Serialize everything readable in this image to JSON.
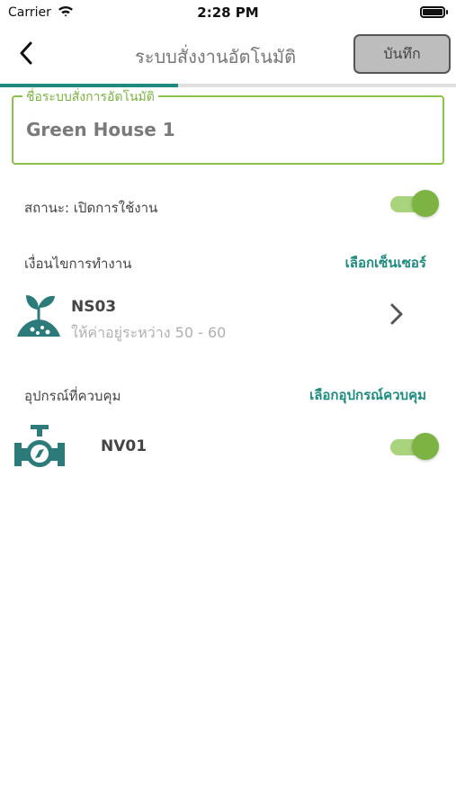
{
  "status_bar": {
    "carrier": "Carrier",
    "time": "2:28 PM"
  },
  "nav": {
    "title": "ระบบสั่งงานอัตโนมัติ",
    "save_label": "บันทึก",
    "progress_percent": 39
  },
  "form": {
    "name_label": "ชื่อระบบสั่งการอัตโนมัติ",
    "name_value": "Green House 1"
  },
  "status": {
    "label": "สถานะ: เปิดการใช้งาน",
    "enabled": true
  },
  "condition": {
    "label": "เงื่อนไขการทำงาน",
    "select_sensor_label": "เลือกเซ็นเซอร์",
    "sensor": {
      "name": "NS03",
      "range": "ให้ค่าอยู่ระหว่าง 50 - 60",
      "icon": "plant-soil-icon"
    }
  },
  "devices": {
    "label": "อุปกรณ์ที่ควบคุม",
    "select_device_label": "เลือกอุปกรณ์ควบคุม",
    "device": {
      "name": "NV01",
      "icon": "valve-icon",
      "enabled": true
    }
  },
  "colors": {
    "accent": "#1e8b80",
    "green": "#7cb342",
    "icon": "#2d7a7a"
  }
}
